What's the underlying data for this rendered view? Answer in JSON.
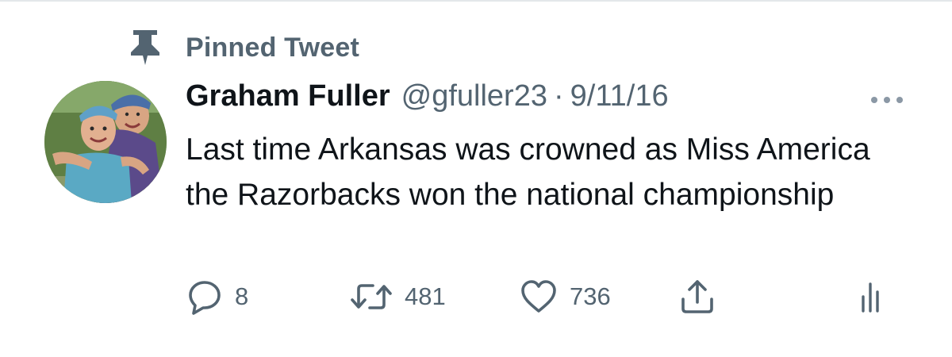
{
  "pinned": {
    "label": "Pinned Tweet",
    "icon": "pin-icon"
  },
  "tweet": {
    "author_name": "Graham Fuller",
    "author_handle": "@gfuller23",
    "separator": "·",
    "date": "9/11/16",
    "text": "Last time Arkansas was crowned as Miss America the Razorbacks won the national championship",
    "more_icon": "more-options-icon"
  },
  "actions": {
    "reply": {
      "icon": "reply-icon",
      "count": "8"
    },
    "retweet": {
      "icon": "retweet-icon",
      "count": "481"
    },
    "like": {
      "icon": "like-icon",
      "count": "736"
    },
    "share": {
      "icon": "share-icon"
    },
    "analytics": {
      "icon": "analytics-icon"
    }
  },
  "colors": {
    "text_primary": "#0f1419",
    "text_secondary": "#536471",
    "divider": "#e3e7ea"
  }
}
